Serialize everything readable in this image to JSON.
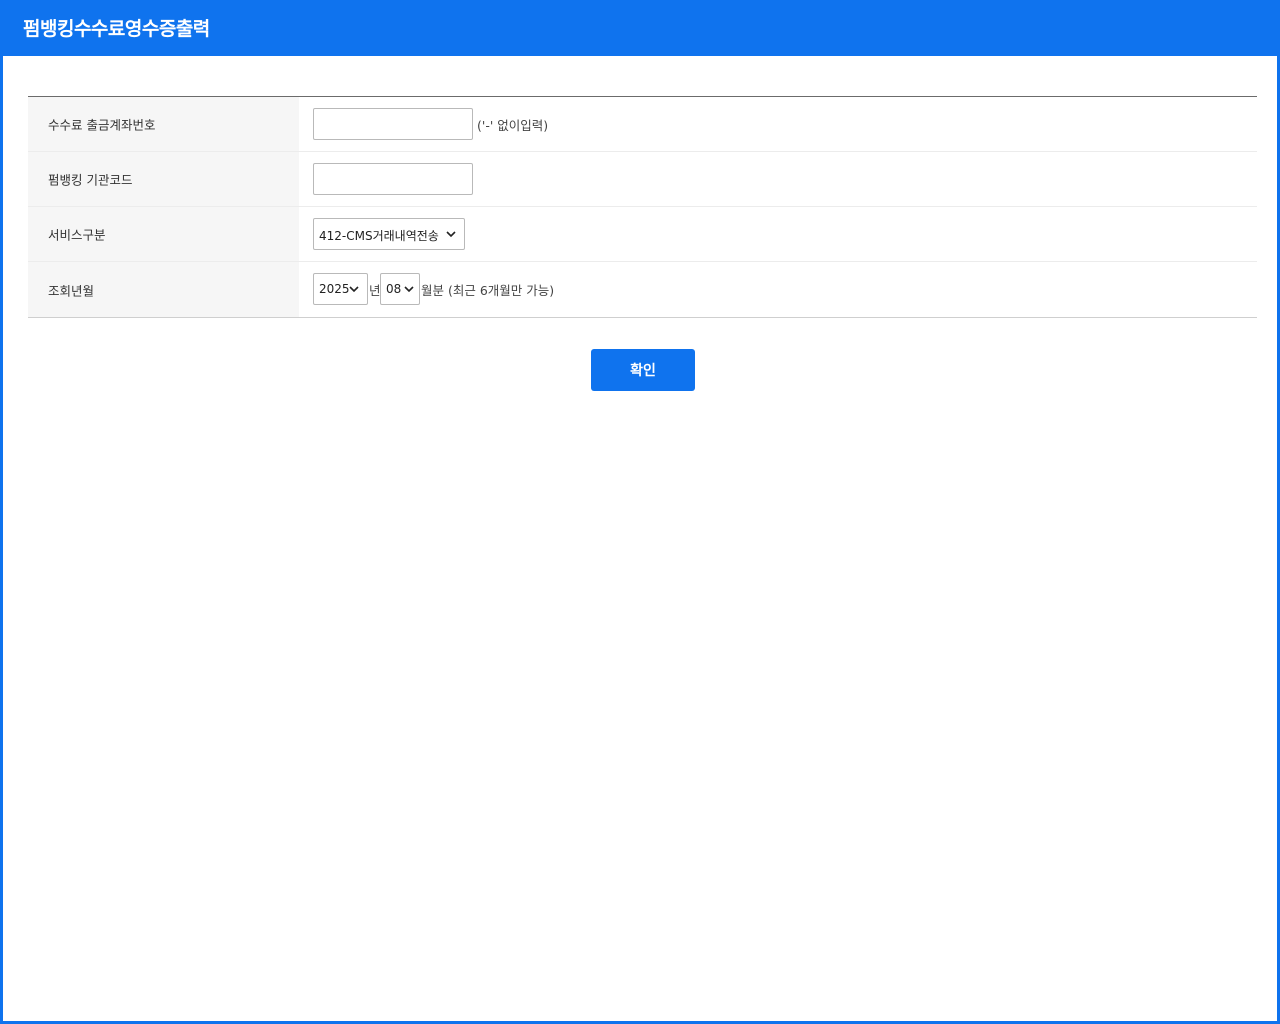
{
  "window": {
    "title": "펌뱅킹수수료영수증출력"
  },
  "form": {
    "rows": [
      {
        "label": "수수료 출금계좌번호",
        "value": "",
        "hint": "('-' 없이입력)"
      },
      {
        "label": "펌뱅킹 기관코드",
        "value": ""
      },
      {
        "label": "서비스구분",
        "selected": "412-CMS거래내역전송"
      },
      {
        "label": "조회년월",
        "year": "2025",
        "year_suffix": "년",
        "month": "08",
        "month_suffix": "월분 (최근 6개월만 가능)"
      }
    ]
  },
  "actions": {
    "confirm_label": "확인"
  },
  "colors": {
    "accent": "#0f73ee",
    "label_bg": "#f6f6f6"
  },
  "icons": {
    "dropdown": "chevron-down-icon"
  }
}
